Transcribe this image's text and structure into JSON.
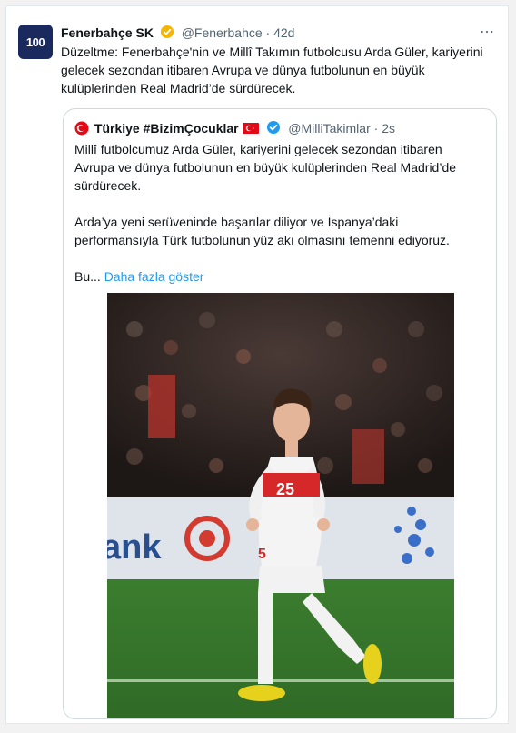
{
  "tweet": {
    "avatar_text": "100",
    "display_name": "Fenerbahçe SK",
    "handle": "@Fenerbahce",
    "separator": "·",
    "time": "42d",
    "more_icon": "⋯",
    "text": "Düzeltme: Fenerbahçe'nin ve Millî Takımın futbolcusu Arda Güler, kariyerini gelecek sezondan itibaren Avrupa ve dünya futbolunun en büyük kulüplerinden Real Madrid’de sürdürecek."
  },
  "quote": {
    "display_name": "Türkiye #BizimÇocuklar",
    "handle": "@MilliTakimlar",
    "separator": "·",
    "time": "2s",
    "paragraphs": [
      "Millî futbolcumuz Arda Güler, kariyerini gelecek sezondan itibaren Avrupa ve dünya futbolunun en büyük kulüplerinden Real Madrid’de sürdürecek.",
      "Arda’ya yeni serüveninde başarılar diliyor ve İspanya’daki performansıyla Türk futbolunun yüz akı olmasını temenni ediyoruz."
    ],
    "truncated": "Bu...",
    "show_more": "Daha fazla göster",
    "photo_text": {
      "banner": "ank",
      "jersey_number": "25",
      "shorts_number": "5"
    }
  },
  "colors": {
    "link": "#1d9bf0",
    "verified": "#f5b400",
    "verified_blue": "#1d9bf0",
    "turkey_red": "#e30a17"
  }
}
